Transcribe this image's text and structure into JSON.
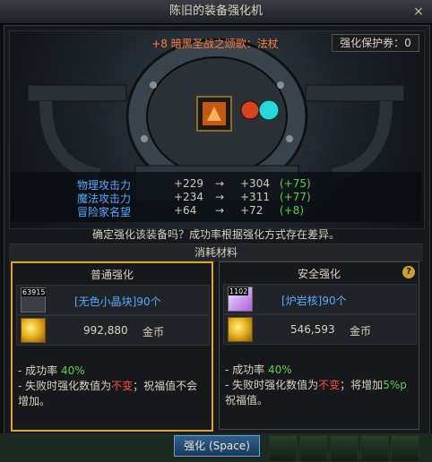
{
  "window": {
    "title": "陈旧的装备强化机",
    "close_label": "×"
  },
  "item": {
    "name": "+8 暗黑圣战之颂歌：法杖"
  },
  "protect_ticket": {
    "label": "强化保护券：0"
  },
  "stats": [
    {
      "name": "物理攻击力",
      "before": "+229",
      "after": "+304",
      "diff": "(+75)"
    },
    {
      "name": "魔法攻击力",
      "before": "+234",
      "after": "+311",
      "diff": "(+77)"
    },
    {
      "name": "冒险家名望",
      "before": "+64",
      "after": "+72",
      "diff": "(+8)"
    }
  ],
  "arrow": "→",
  "confirm_text": "确定强化该装备吗？成功率根据强化方式存在差异。",
  "materials_header": "消耗材料",
  "normal": {
    "title": "普通强化",
    "material_count": "63915",
    "material_name": "[无色小晶块]90个",
    "gold_value": "992,880",
    "gold_unit": "金币",
    "rate_prefix": "- 成功率 ",
    "rate_value": "40%",
    "fail_prefix": "- 失败时强化数值为",
    "fail_red": "不变",
    "fail_suffix": "；祝福值不会增加。"
  },
  "safe": {
    "title": "安全强化",
    "help": "?",
    "material_count": "1102",
    "material_name": "[炉岩核]90个",
    "gold_value": "546,593",
    "gold_unit": "金币",
    "rate_prefix": "- 成功率 ",
    "rate_value": "40%",
    "fail_prefix": "- 失败时强化数值为",
    "fail_red": "不变",
    "fail_mid": "；将增加",
    "fail_green": "5%p",
    "fail_suffix": "祝福值。"
  },
  "enhance_button": "强化 (Space)",
  "colors": {
    "accent": "#e3a51d",
    "stat_name": "#58a8ff",
    "diff": "#5fcf47",
    "warn": "#ff4a3a",
    "item_name": "#ff7a3c"
  }
}
